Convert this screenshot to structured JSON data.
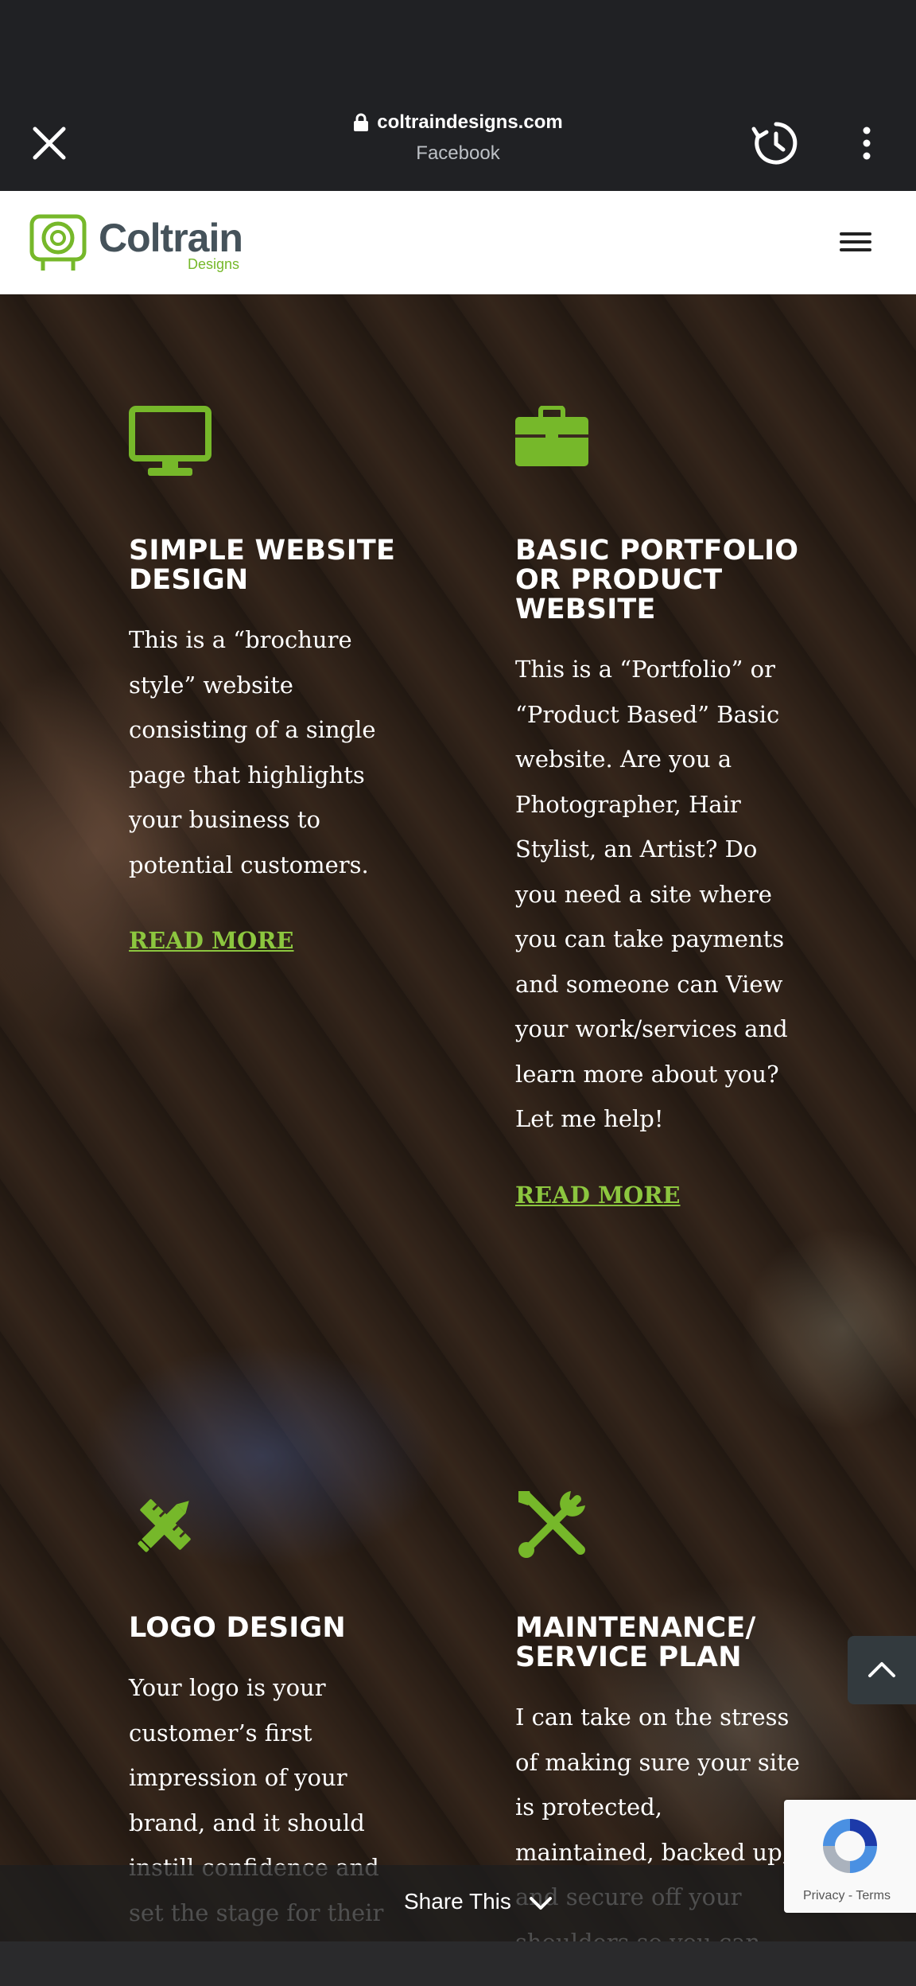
{
  "browser": {
    "url": "coltraindesigns.com",
    "source": "Facebook",
    "icons": {
      "close": "close-icon",
      "lock": "lock-icon",
      "history": "history-icon",
      "more": "more-vert-icon"
    }
  },
  "site": {
    "logo_text": "Coltrain",
    "logo_sub": "Designs",
    "brand_green": "#76b82a",
    "menu_icon": "hamburger-icon"
  },
  "services": [
    {
      "icon": "desktop-monitor-icon",
      "title": "SIMPLE WEBSITE DESIGN",
      "description": "This is a “brochure style” website consisting of a single page that highlights your business to potential customers.",
      "link": "READ MORE"
    },
    {
      "icon": "briefcase-icon",
      "title": "BASIC PORTFOLIO OR PRODUCT WEBSITE",
      "description": "This is a “Portfolio” or “Product Based” Basic website. Are you a Photographer, Hair Stylist, an Artist? Do you need a site where you can take payments and someone can View your work/services and learn more about you? Let me help!",
      "link": "READ MORE"
    },
    {
      "icon": "pencil-ruler-icon",
      "title": "LOGO DESIGN",
      "description": "Your logo is your customer’s first impression of your brand, and it should instill confidence and set the stage for their"
    },
    {
      "icon": "wrench-screwdriver-icon",
      "title": "MAINTENANCE/ SERVICE PLAN",
      "description": "I can take on the stress of making sure your site is protected, maintained, backed up, and secure off your shoulders so you can get back to the things you"
    }
  ],
  "share_bar": {
    "label": "Share This"
  },
  "recaptcha": {
    "text": "Privacy - Terms"
  },
  "accent_color": "#8cc63f"
}
